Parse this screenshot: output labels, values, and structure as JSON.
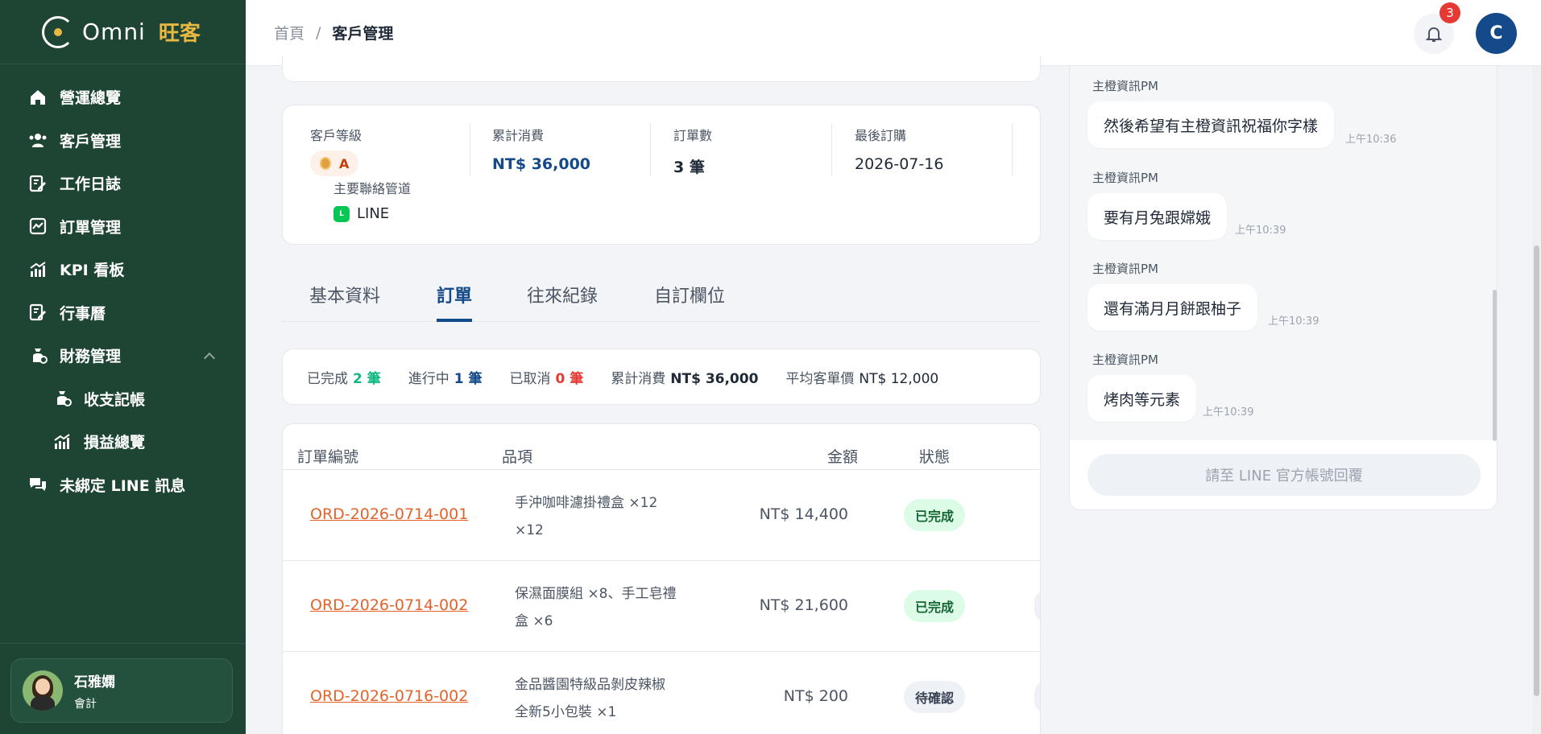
{
  "brand": {
    "name": "Omni",
    "cn": "旺客"
  },
  "sidebar": {
    "items": [
      {
        "label": "營運總覽",
        "icon": "home-icon"
      },
      {
        "label": "客戶管理",
        "icon": "users-icon"
      },
      {
        "label": "工作日誌",
        "icon": "edit-note-icon"
      },
      {
        "label": "訂單管理",
        "icon": "chart-line-icon"
      },
      {
        "label": "KPI 看板",
        "icon": "bar-chart-icon"
      },
      {
        "label": "行事曆",
        "icon": "calendar-edit-icon"
      },
      {
        "label": "財務管理",
        "icon": "money-bag-icon"
      },
      {
        "label": "收支記帳",
        "icon": "money-bag-icon"
      },
      {
        "label": "損益總覽",
        "icon": "bar-chart-icon"
      },
      {
        "label": "未綁定 LINE 訊息",
        "icon": "chat-icon"
      }
    ],
    "user": {
      "name": "石雅嫻",
      "role": "會計"
    }
  },
  "topbar": {
    "crumb_home": "首頁",
    "crumb_sep": "/",
    "crumb_current": "客戶管理",
    "notification_count": "3",
    "avatar_initial": "C"
  },
  "stats": {
    "grade_label": "客戶等級",
    "grade_value": "A",
    "total_label": "累計消費",
    "total_value": "NT$ 36,000",
    "orders_label": "訂單數",
    "orders_value": "3 筆",
    "last_label": "最後訂購",
    "last_value": "2026-07-16",
    "channel_label": "主要聯絡管道",
    "channel_value": "LINE"
  },
  "tabs": [
    "基本資料",
    "訂單",
    "往來紀錄",
    "自訂欄位"
  ],
  "summary": {
    "done_label": "已完成",
    "done_value": "2 筆",
    "progress_label": "進行中",
    "progress_value": "1 筆",
    "cancel_label": "已取消",
    "cancel_value": "0 筆",
    "total_label": "累計消費",
    "total_value": "NT$ 36,000",
    "avg_label": "平均客單價",
    "avg_value": "NT$ 12,000"
  },
  "table": {
    "headers": [
      "訂單編號",
      "品項",
      "金額",
      "狀態"
    ],
    "rows": [
      {
        "id": "ORD-2026-0714-001",
        "items1": "手沖咖啡濾掛禮盒 ×12",
        "items2": "×12",
        "amount": "NT$ 14,400",
        "status": "已完成"
      },
      {
        "id": "ORD-2026-0714-002",
        "items1": "保濕面膜組 ×8、手工皂禮",
        "items2": "盒 ×6",
        "amount": "NT$ 21,600",
        "status": "已完成"
      },
      {
        "id": "ORD-2026-0716-002",
        "items1": "金品醬園特級品剝皮辣椒",
        "items2": "全新5小包裝 ×1",
        "amount": "NT$ 200",
        "status": "待確認"
      }
    ]
  },
  "chat": {
    "messages": [
      {
        "sender": "主橙資訊PM",
        "text": "然後希望有主橙資訊祝福你字樣",
        "time": "上午10:36"
      },
      {
        "sender": "主橙資訊PM",
        "text": "要有月兔跟嫦娥",
        "time": "上午10:39"
      },
      {
        "sender": "主橙資訊PM",
        "text": "還有滿月月餅跟柚子",
        "time": "上午10:39"
      },
      {
        "sender": "主橙資訊PM",
        "text": "烤肉等元素",
        "time": "上午10:39"
      }
    ],
    "reply_placeholder": "請至 LINE 官方帳號回覆"
  }
}
